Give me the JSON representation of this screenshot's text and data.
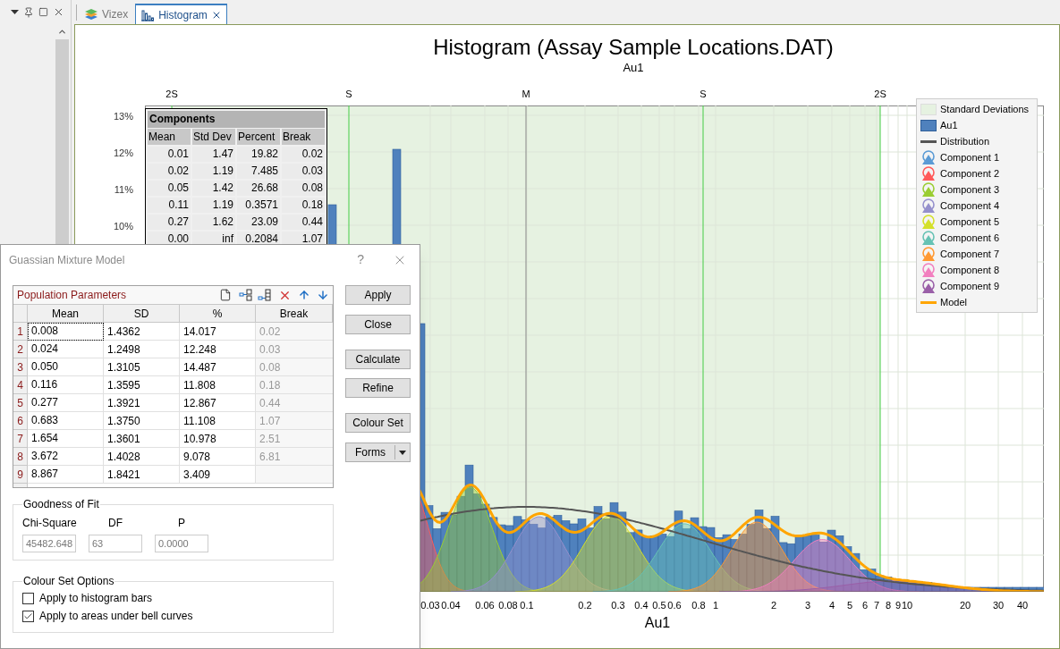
{
  "tabs": [
    {
      "label": "Vizex",
      "selected": false
    },
    {
      "label": "Histogram",
      "selected": true
    }
  ],
  "chart": {
    "title": "Histogram (Assay Sample Locations.DAT)",
    "subtitle": "Au1",
    "sd_markers": [
      "2S",
      "S",
      "M",
      "S",
      "2S"
    ],
    "y_ticks": [
      "13%",
      "12%",
      "11%",
      "10%"
    ],
    "x_ticks": [
      "0.03",
      "0.04",
      "0.06",
      "0.08",
      "0.1",
      "0.2",
      "0.3",
      "0.4",
      "0.5",
      "0.6",
      "0.8",
      "1",
      "2",
      "3",
      "4",
      "5",
      "6",
      "7",
      "8",
      "9",
      "10",
      "20",
      "30",
      "40"
    ],
    "x_axis_title": "Au1",
    "components_table": {
      "title": "Components",
      "columns": [
        "Mean",
        "Std Dev",
        "Percent",
        "Break"
      ],
      "rows": [
        [
          "0.01",
          "1.47",
          "19.82",
          "0.02"
        ],
        [
          "0.02",
          "1.19",
          "7.485",
          "0.03"
        ],
        [
          "0.05",
          "1.42",
          "26.68",
          "0.08"
        ],
        [
          "0.11",
          "1.19",
          "0.3571",
          "0.18"
        ],
        [
          "0.27",
          "1.62",
          "23.09",
          "0.44"
        ],
        [
          "0.00",
          "inf",
          "0.2084",
          "1.07"
        ]
      ]
    },
    "legend": [
      {
        "label": "Standard Deviations",
        "kind": "band",
        "color": "#e6f2e1"
      },
      {
        "label": "Au1",
        "kind": "bar",
        "color": "#4f81bd"
      },
      {
        "label": "Distribution",
        "kind": "line",
        "color": "#555555"
      },
      {
        "label": "Component 1",
        "kind": "component",
        "color": "#5b9bd5"
      },
      {
        "label": "Component 2",
        "kind": "component",
        "color": "#ff5a5a"
      },
      {
        "label": "Component 3",
        "kind": "component",
        "color": "#9acd32"
      },
      {
        "label": "Component 4",
        "kind": "component",
        "color": "#9590cc"
      },
      {
        "label": "Component 5",
        "kind": "component",
        "color": "#d4e02a"
      },
      {
        "label": "Component 6",
        "kind": "component",
        "color": "#66c2b4"
      },
      {
        "label": "Component 7",
        "kind": "component",
        "color": "#ff9933"
      },
      {
        "label": "Component 8",
        "kind": "component",
        "color": "#f27fbf"
      },
      {
        "label": "Component 9",
        "kind": "component",
        "color": "#9a5fa8"
      },
      {
        "label": "Model",
        "kind": "line",
        "color": "#ffa500"
      }
    ]
  },
  "dialog": {
    "title": "Guassian Mixture Model",
    "help": "?",
    "grid": {
      "title": "Population Parameters",
      "columns": [
        "Mean",
        "SD",
        "%",
        "Break"
      ],
      "rows": [
        {
          "number": "1",
          "mean": "0.008",
          "sd": "1.4362",
          "percent": "14.017",
          "break": "0.02",
          "selected": true
        },
        {
          "number": "2",
          "mean": "0.024",
          "sd": "1.2498",
          "percent": "12.248",
          "break": "0.03",
          "selected": false
        },
        {
          "number": "3",
          "mean": "0.050",
          "sd": "1.3105",
          "percent": "14.487",
          "break": "0.08",
          "selected": false
        },
        {
          "number": "4",
          "mean": "0.116",
          "sd": "1.3595",
          "percent": "11.808",
          "break": "0.18",
          "selected": false
        },
        {
          "number": "5",
          "mean": "0.277",
          "sd": "1.3921",
          "percent": "12.867",
          "break": "0.44",
          "selected": false
        },
        {
          "number": "6",
          "mean": "0.683",
          "sd": "1.3750",
          "percent": "11.108",
          "break": "1.07",
          "selected": false
        },
        {
          "number": "7",
          "mean": "1.654",
          "sd": "1.3601",
          "percent": "10.978",
          "break": "2.51",
          "selected": false
        },
        {
          "number": "8",
          "mean": "3.672",
          "sd": "1.4028",
          "percent": "9.078",
          "break": "6.81",
          "selected": false
        },
        {
          "number": "9",
          "mean": "8.867",
          "sd": "1.8421",
          "percent": "3.409",
          "selected": false
        }
      ]
    },
    "buttons": [
      {
        "label": "Apply",
        "kind": "plain"
      },
      {
        "label": "Close",
        "kind": "plain"
      },
      {
        "label": "Calculate",
        "kind": "plain"
      },
      {
        "label": "Refine",
        "kind": "plain"
      },
      {
        "label": "Colour Set",
        "kind": "plain"
      },
      {
        "label": "Forms",
        "kind": "split"
      }
    ],
    "goodness_of_fit": {
      "title": "Goodness of Fit",
      "fields": [
        {
          "label": "Chi-Square",
          "value": "45482.648",
          "disabled": true
        },
        {
          "label": "DF",
          "value": "63",
          "disabled": true
        },
        {
          "label": "P",
          "value": "0.0000",
          "disabled": true
        }
      ]
    },
    "colour_set_options": {
      "title": "Colour Set Options",
      "options": [
        {
          "label": "Apply to histogram bars",
          "checked": false
        },
        {
          "label": "Apply to areas under bell curves",
          "checked": true
        }
      ]
    }
  }
}
